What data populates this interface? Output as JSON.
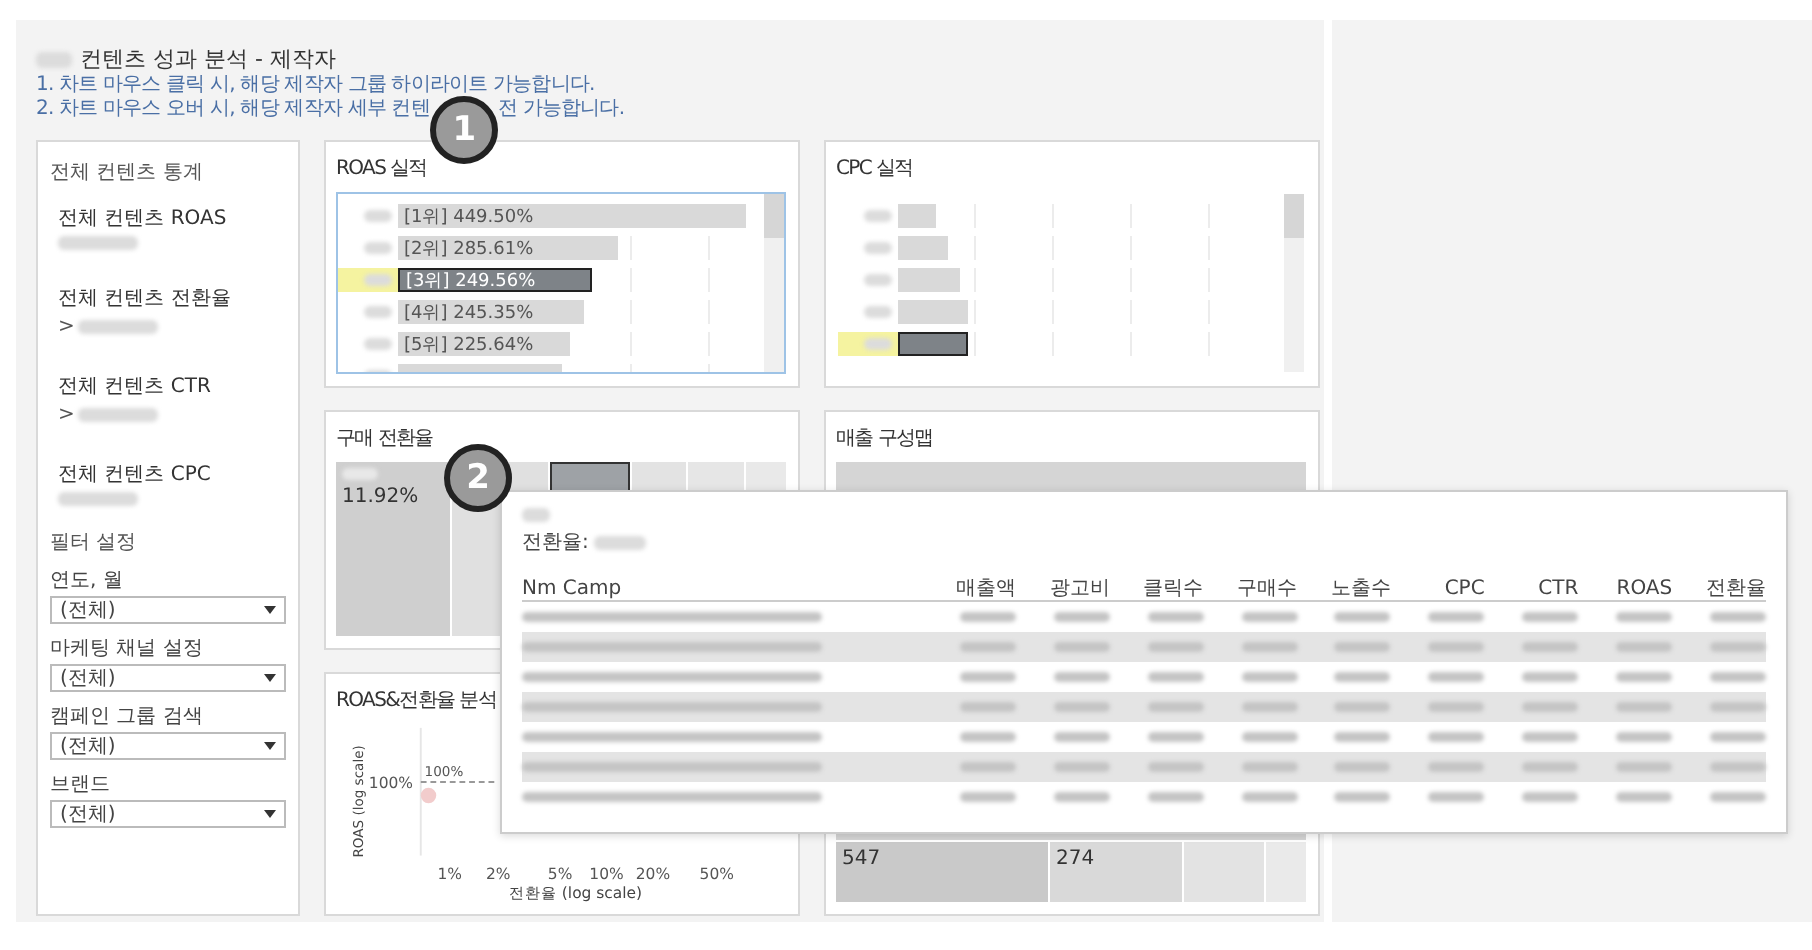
{
  "title": {
    "text": "컨텐츠 성과 분석 - 제작자"
  },
  "notes": [
    {
      "parts": [
        "1. 차트 마우스 클릭 시, 해당 제작자 그룹 하이라이트 가능합니다."
      ]
    },
    {
      "parts": [
        "2. 차트 마우스 오버 시, 해당 제작자 세부 컨텐",
        "전 가능합니다."
      ]
    }
  ],
  "badges": [
    "1",
    "2"
  ],
  "summary": {
    "title": "전체 컨텐츠 통계",
    "stats": [
      {
        "label": "전체 컨텐츠 ROAS"
      },
      {
        "label": "전체 컨텐츠 전환율",
        "prefix": ">"
      },
      {
        "label": "전체 컨텐츠 CTR",
        "prefix": ">"
      },
      {
        "label": "전체 컨텐츠 CPC"
      }
    ]
  },
  "filters": {
    "title": "필터 설정",
    "items": [
      {
        "label": "연도, 월",
        "value": "(전체)"
      },
      {
        "label": "마케팅 채널 설정",
        "value": "(전체)"
      },
      {
        "label": "캠페인 그룹 검색",
        "value": "(전체)"
      },
      {
        "label": "브랜드",
        "value": "(전체)"
      }
    ]
  },
  "roas_chart": {
    "title": "ROAS 실적",
    "bars": [
      {
        "label": "[1위] 449.50%",
        "level": 0.95,
        "selected": false
      },
      {
        "label": "[2위] 285.61%",
        "level": 0.6,
        "selected": false
      },
      {
        "label": "[3위] 249.56%",
        "level": 0.53,
        "selected": true
      },
      {
        "label": "[4위] 245.35%",
        "level": 0.51,
        "selected": false
      },
      {
        "label": "[5위] 225.64%",
        "level": 0.47,
        "selected": false
      },
      {
        "level": 0.45,
        "selected": false
      }
    ]
  },
  "cpc_chart": {
    "title": "CPC 실적",
    "bars": [
      {
        "level": 0.1,
        "selected": false
      },
      {
        "level": 0.13,
        "selected": false
      },
      {
        "level": 0.16,
        "selected": false
      },
      {
        "level": 0.18,
        "selected": false
      },
      {
        "level": 0.18,
        "selected": true
      }
    ]
  },
  "conversion_treemap": {
    "title": "구매 전환율",
    "tiles": [
      {
        "value": "11.92%",
        "selected": false
      },
      {
        "selected": false
      },
      {
        "selected": true
      },
      {
        "selected": false
      },
      {
        "selected": false
      },
      {
        "selected": false
      }
    ]
  },
  "sales_treemap": {
    "title": "매출 구성맵",
    "tiles": [
      {
        "value": "547"
      },
      {
        "value": "274"
      }
    ]
  },
  "scatter": {
    "title": "ROAS&전환율 분석",
    "y_tick_label": "100%",
    "reference_label": "100%",
    "xlabel": "전환율 (log scale)",
    "ylabel": "ROAS (log scale)",
    "xticks": [
      "1%",
      "2%",
      "5%",
      "10%",
      "20%",
      "50%"
    ]
  },
  "tooltip": {
    "metric_label": "전환율:",
    "columns": [
      "Nm Camp",
      "매출액",
      "광고비",
      "클릭수",
      "구매수",
      "노출수",
      "CPC",
      "CTR",
      "ROAS",
      "전환율"
    ],
    "rows": [
      {
        "striped": false
      },
      {
        "striped": true
      },
      {
        "striped": false
      },
      {
        "striped": true
      },
      {
        "striped": false
      },
      {
        "striped": true
      },
      {
        "striped": false
      }
    ]
  }
}
